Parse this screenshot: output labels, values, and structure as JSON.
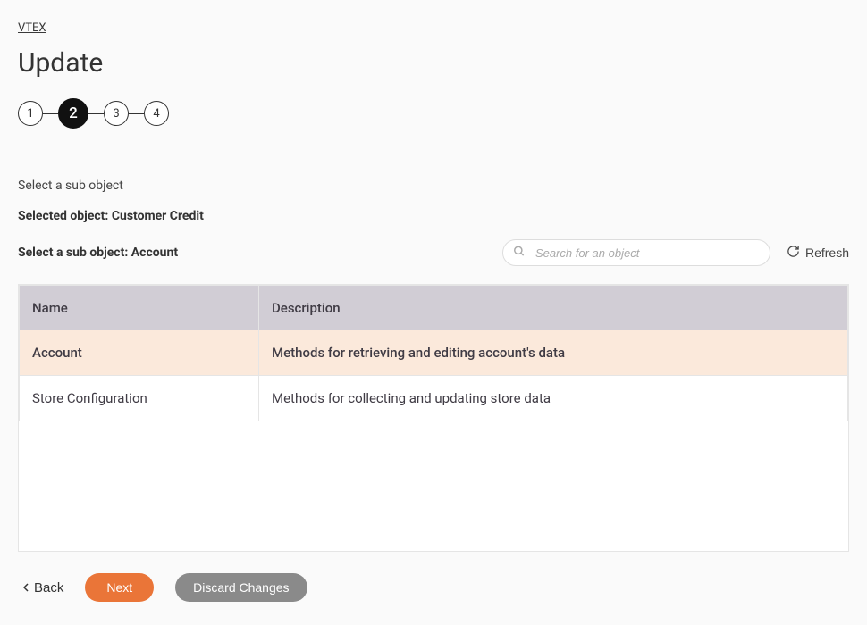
{
  "breadcrumb": "VTEX",
  "page_title": "Update",
  "steps": [
    "1",
    "2",
    "3",
    "4"
  ],
  "active_step_index": 1,
  "subtitle": "Select a sub object",
  "selected_object_label": "Selected object: Customer Credit",
  "subobject_label": "Select a sub object: Account",
  "search": {
    "placeholder": "Search for an object",
    "value": ""
  },
  "refresh_label": "Refresh",
  "table": {
    "headers": {
      "name": "Name",
      "description": "Description"
    },
    "rows": [
      {
        "name": "Account",
        "description": "Methods for retrieving and editing account's data",
        "selected": true
      },
      {
        "name": "Store Configuration",
        "description": "Methods for collecting and updating store data",
        "selected": false
      }
    ]
  },
  "actions": {
    "back": "Back",
    "next": "Next",
    "discard": "Discard Changes"
  }
}
